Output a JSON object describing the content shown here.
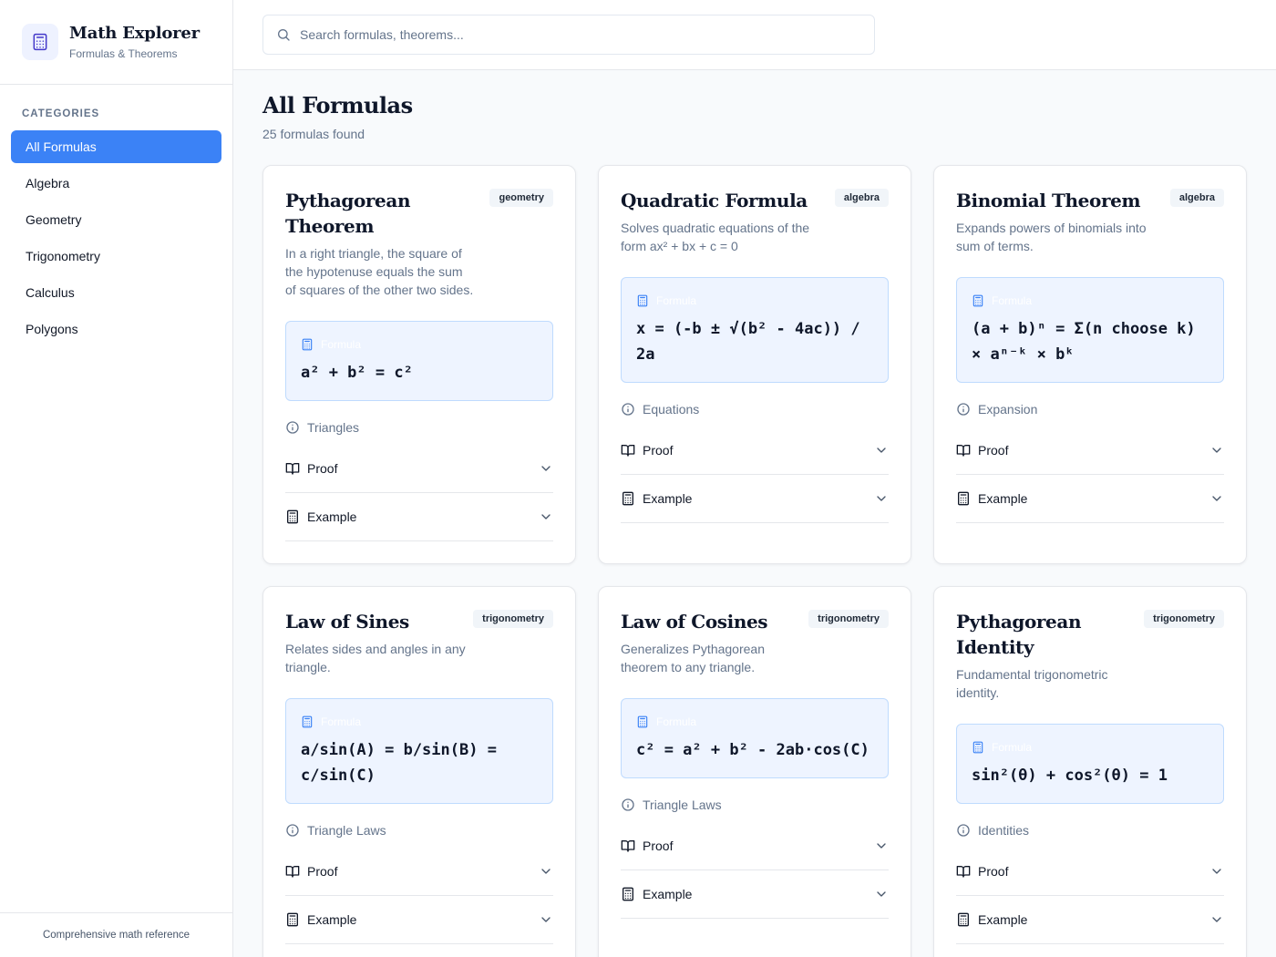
{
  "sidebar": {
    "app_title": "Math Explorer",
    "app_subtitle": "Formulas & Theorems",
    "categories_label": "CATEGORIES",
    "items": [
      {
        "label": "All Formulas",
        "active": true
      },
      {
        "label": "Algebra",
        "active": false
      },
      {
        "label": "Geometry",
        "active": false
      },
      {
        "label": "Trigonometry",
        "active": false
      },
      {
        "label": "Calculus",
        "active": false
      },
      {
        "label": "Polygons",
        "active": false
      }
    ],
    "footer": "Comprehensive math reference"
  },
  "search": {
    "placeholder": "Search formulas, theorems...",
    "value": ""
  },
  "main": {
    "title": "All Formulas",
    "count_text": "25 formulas found",
    "formula_label": "Formula",
    "proof_label": "Proof",
    "example_label": "Example"
  },
  "colors": {
    "accent": "#3b82f6",
    "formula_bg": "#eef4ff",
    "formula_border": "#bfdbfe"
  },
  "cards": [
    {
      "title": "Pythagorean Theorem",
      "badge": "geometry",
      "description": "In a right triangle, the square of the hypotenuse equals the sum of squares of the other two sides.",
      "formula": "a² + b² = c²",
      "category": "Triangles"
    },
    {
      "title": "Quadratic Formula",
      "badge": "algebra",
      "description": "Solves quadratic equations of the form ax² + bx + c = 0",
      "formula": "x = (-b ± √(b² - 4ac)) / 2a",
      "category": "Equations"
    },
    {
      "title": "Binomial Theorem",
      "badge": "algebra",
      "description": "Expands powers of binomials into sum of terms.",
      "formula": "(a + b)ⁿ = Σ(n choose k) × aⁿ⁻ᵏ × bᵏ",
      "category": "Expansion"
    },
    {
      "title": "Law of Sines",
      "badge": "trigonometry",
      "description": "Relates sides and angles in any triangle.",
      "formula": "a/sin(A) = b/sin(B) = c/sin(C)",
      "category": "Triangle Laws"
    },
    {
      "title": "Law of Cosines",
      "badge": "trigonometry",
      "description": "Generalizes Pythagorean theorem to any triangle.",
      "formula": "c² = a² + b² - 2ab·cos(C)",
      "category": "Triangle Laws"
    },
    {
      "title": "Pythagorean Identity",
      "badge": "trigonometry",
      "description": "Fundamental trigonometric identity.",
      "formula": "sin²(θ) + cos²(θ) = 1",
      "category": "Identities"
    }
  ]
}
